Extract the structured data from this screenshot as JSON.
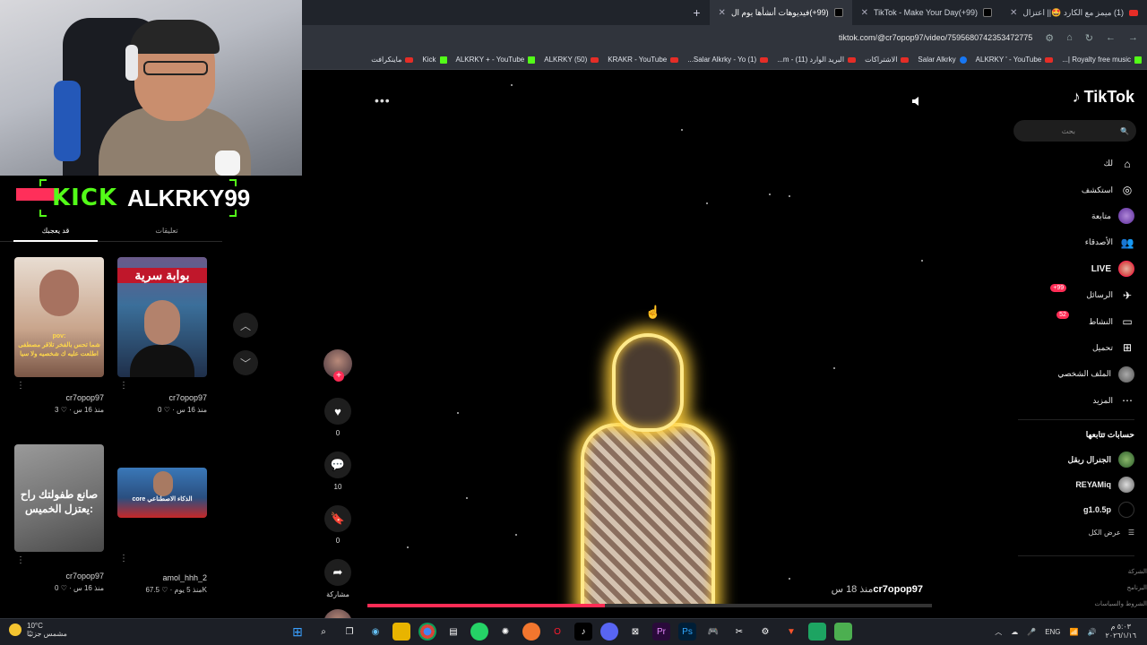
{
  "browser": {
    "tabs": [
      {
        "label": "(1) ميمز مع الكارد 🤩|| اعتزال",
        "icon": "youtube-icon",
        "active": false
      },
      {
        "label": "(99+)TikTok - Make Your Day",
        "icon": "tiktok-icon",
        "active": false
      },
      {
        "label": "(99+)فيديوهات أنشأها يوم ال",
        "icon": "tiktok-icon",
        "active": true
      }
    ],
    "new_tab": "+",
    "url": "tiktok.com/@cr7opop97/video/7595680742353472775",
    "bookmarks": [
      {
        "label": "Royalty free music |...",
        "icon": "link"
      },
      {
        "label": "ALKRKY ' - YouTube",
        "icon": "youtube"
      },
      {
        "label": "Salar Alkrky",
        "icon": "facebook"
      },
      {
        "label": "الاشتراكات",
        "icon": "youtube"
      },
      {
        "label": "البريد الوارد (11) - m...",
        "icon": "mail"
      },
      {
        "label": "(1) Salar Alkrky - Yo...",
        "icon": "youtube"
      },
      {
        "label": "KRAKR - YouTube",
        "icon": "youtube"
      },
      {
        "label": "(50) ALKRKY",
        "icon": "reddit"
      },
      {
        "label": "ALKRKY + - YouTube",
        "icon": "kick"
      },
      {
        "label": "Kick",
        "icon": "kick"
      },
      {
        "label": "ماينكرافت",
        "icon": "youtube"
      }
    ]
  },
  "stream": {
    "kick_label": "KICK",
    "channel_name": "ALKRKY99"
  },
  "left_panel": {
    "tabs": [
      {
        "label": "قد يعجبك",
        "active": true
      },
      {
        "label": "تعليقات",
        "active": false
      }
    ],
    "cards": [
      {
        "author": "cr7opop97",
        "time": "منذ 16 س",
        "likes": "3",
        "thumb_text": "pov:\nشما تحس بالفخر تلاقر مصطفى اطلعت عليه ك شخصيه ولا سيا"
      },
      {
        "author": "cr7opop97",
        "time": "منذ 16 س",
        "likes": "0",
        "thumb_text": "بوابة سرية"
      },
      {
        "author": "cr7opop97",
        "time": "منذ 16 س",
        "likes": "0",
        "thumb_text": "صانع طفولتك راح يعتزل الخميس:"
      },
      {
        "author": "amol_hhh_2",
        "time": "منذ 5 يوم",
        "likes": "67.5K",
        "thumb_text": "core الذكاء الاصطناعي"
      }
    ]
  },
  "video": {
    "author": "cr7opop97",
    "time_ago": "منذ 18 س",
    "progress_pct": 42,
    "menu": "•••"
  },
  "actions": {
    "likes": "0",
    "comments": "10",
    "saves": "0",
    "share_label": "مشاركة"
  },
  "sidebar": {
    "logo": "TikTok",
    "search_placeholder": "بحث",
    "menu": [
      {
        "label": "لك",
        "icon": "home-icon"
      },
      {
        "label": "استكشف",
        "icon": "compass-icon"
      },
      {
        "label": "متابعة",
        "icon": "avatar"
      },
      {
        "label": "الأصدقاء",
        "icon": "friends-icon"
      },
      {
        "label": "LIVE",
        "icon": "live-icon"
      },
      {
        "label": "الرسائل",
        "icon": "message-icon",
        "badge": "99+"
      },
      {
        "label": "النشاط",
        "icon": "activity-icon",
        "badge": "52"
      },
      {
        "label": "تحميل",
        "icon": "upload-icon"
      },
      {
        "label": "الملف الشخصي",
        "icon": "profile-avatar"
      },
      {
        "label": "المزيد",
        "icon": "more-icon"
      }
    ],
    "following_title": "حسابات تتابعها",
    "following": [
      {
        "name": "الجنرال ربقل"
      },
      {
        "name": "REYAMiq"
      },
      {
        "name": "g1.0.5p"
      }
    ],
    "see_all": "عرض الكل",
    "footer": [
      "الشركة",
      "البرنامج",
      "الشروط والسياسات"
    ]
  },
  "taskbar": {
    "weather_temp": "10°C",
    "weather_desc": "مشمس جزئيًا",
    "lang": "ENG",
    "time": "٥:٠٣ م",
    "date": "٢٠٢٦/١/١٦"
  },
  "colors": {
    "tiktok_red": "#fe2c55",
    "kick_green": "#53fc18",
    "glow": "#ffcf3a"
  }
}
